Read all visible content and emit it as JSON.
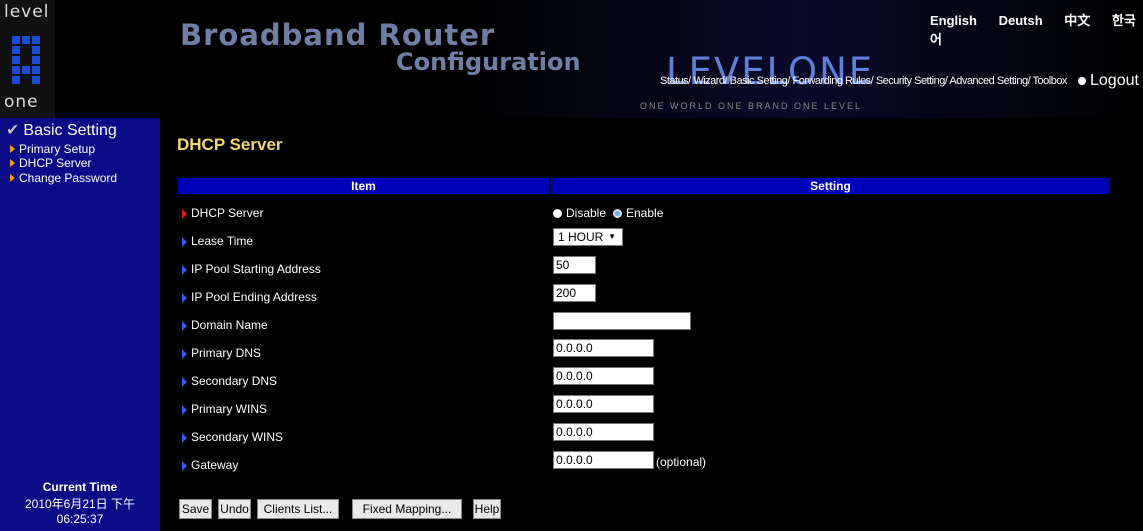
{
  "header": {
    "logo_top": "level",
    "logo_bottom": "one",
    "title_line1": "Broadband Router",
    "title_line2": "Configuration",
    "brand": "LEVELONE",
    "tagline": "ONE WORLD ONE BRAND ONE LEVEL",
    "languages": [
      "English",
      "Deutsh",
      "中文",
      "한국어"
    ],
    "nav": [
      "Status/",
      "Wizard/",
      "Basic Setting/",
      "Forwarding Rules/",
      "Security Setting/",
      "Advanced Setting/",
      "Toolbox"
    ],
    "logout": "Logout"
  },
  "sidebar": {
    "section": "Basic Setting",
    "items": [
      "Primary Setup",
      "DHCP Server",
      "Change Password"
    ],
    "time_label": "Current Time",
    "time_value": "2010年6月21日 下午 06:25:37"
  },
  "main": {
    "title": "DHCP Server",
    "col_item": "Item",
    "col_setting": "Setting",
    "rows": {
      "dhcp_server": "DHCP Server",
      "lease_time": "Lease Time",
      "pool_start": "IP Pool Starting Address",
      "pool_end": "IP Pool Ending Address",
      "domain": "Domain Name",
      "dns1": "Primary DNS",
      "dns2": "Secondary DNS",
      "wins1": "Primary WINS",
      "wins2": "Secondary WINS",
      "gateway": "Gateway"
    },
    "dhcp_options": [
      "Disable",
      "Enable"
    ],
    "dhcp_selected": "Enable",
    "lease_value": "1 HOUR",
    "values": {
      "pool_start": "50",
      "pool_end": "200",
      "domain": "",
      "dns1": "0.0.0.0",
      "dns2": "0.0.0.0",
      "wins1": "0.0.0.0",
      "wins2": "0.0.0.0",
      "gateway": "0.0.0.0"
    },
    "optional": "(optional)",
    "buttons": [
      "Save",
      "Undo",
      "Clients List...",
      "Fixed Mapping...",
      "Help"
    ]
  },
  "colors": {
    "sidebar_bg": "#0b0b88",
    "table_header_bg": "#0000b8",
    "title": "#f5d76e"
  }
}
